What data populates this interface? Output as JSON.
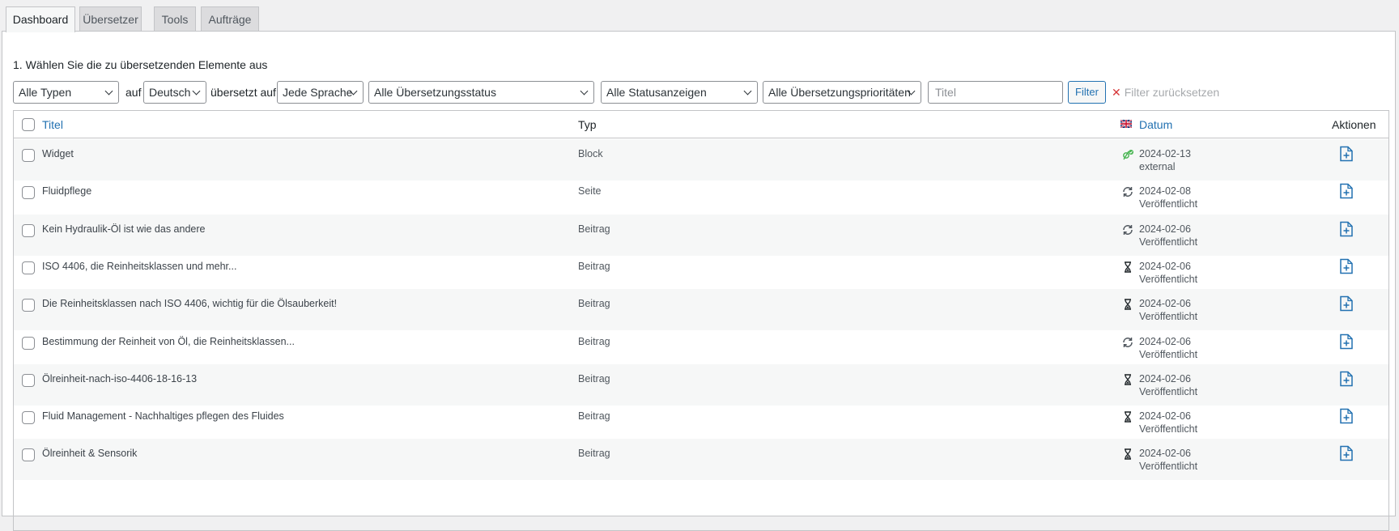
{
  "tabs": [
    {
      "label": "Dashboard",
      "active": true
    },
    {
      "label": "Übersetzer",
      "active": false
    },
    {
      "label": "Tools",
      "active": false
    },
    {
      "label": "Aufträge",
      "active": false
    }
  ],
  "step_label": "1. Wählen Sie die zu übersetzenden Elemente aus",
  "filters": {
    "type_select": "Alle Typen",
    "auf_label": "auf",
    "language_select": "Deutsch",
    "translated_to_label": "übersetzt auf",
    "target_language_select": "Jede Sprache",
    "translation_status_select": "Alle Übersetzungsstatus",
    "status_display_select": "Alle Statusanzeigen",
    "priority_select": "Alle Übersetzungsprioritäten",
    "title_placeholder": "Titel",
    "filter_button": "Filter",
    "reset_label": "Filter zurücksetzen"
  },
  "table": {
    "headers": {
      "title": "Titel",
      "type": "Typ",
      "date": "Datum",
      "actions": "Aktionen"
    },
    "rows": [
      {
        "title": "Widget",
        "type": "Block",
        "status_icon": "translated-icon",
        "date": "2024-02-13",
        "state": "external"
      },
      {
        "title": "Fluidpflege",
        "type": "Seite",
        "status_icon": "needs-update-icon",
        "date": "2024-02-08",
        "state": "Veröffentlicht"
      },
      {
        "title": "Kein Hydraulik-Öl ist wie das andere",
        "type": "Beitrag",
        "status_icon": "needs-update-icon",
        "date": "2024-02-06",
        "state": "Veröffentlicht"
      },
      {
        "title": "ISO 4406, die Reinheitsklassen und mehr...",
        "type": "Beitrag",
        "status_icon": "hourglass-icon",
        "date": "2024-02-06",
        "state": "Veröffentlicht"
      },
      {
        "title": "Die Reinheitsklassen nach ISO 4406, wichtig für die Ölsauberkeit!",
        "type": "Beitrag",
        "status_icon": "hourglass-icon",
        "date": "2024-02-06",
        "state": "Veröffentlicht"
      },
      {
        "title": "Bestimmung der Reinheit von Öl, die Reinheitsklassen...",
        "type": "Beitrag",
        "status_icon": "needs-update-icon",
        "date": "2024-02-06",
        "state": "Veröffentlicht"
      },
      {
        "title": "Ölreinheit-nach-iso-4406-18-16-13",
        "type": "Beitrag",
        "status_icon": "hourglass-icon",
        "date": "2024-02-06",
        "state": "Veröffentlicht"
      },
      {
        "title": "Fluid Management - Nachhaltiges pflegen des Fluides",
        "type": "Beitrag",
        "status_icon": "hourglass-icon",
        "date": "2024-02-06",
        "state": "Veröffentlicht"
      },
      {
        "title": "Ölreinheit & Sensorik",
        "type": "Beitrag",
        "status_icon": "hourglass-icon",
        "date": "2024-02-06",
        "state": "Veröffentlicht"
      }
    ]
  },
  "colors": {
    "link": "#2271b1",
    "success": "#46b450",
    "icon": "#50575e"
  }
}
